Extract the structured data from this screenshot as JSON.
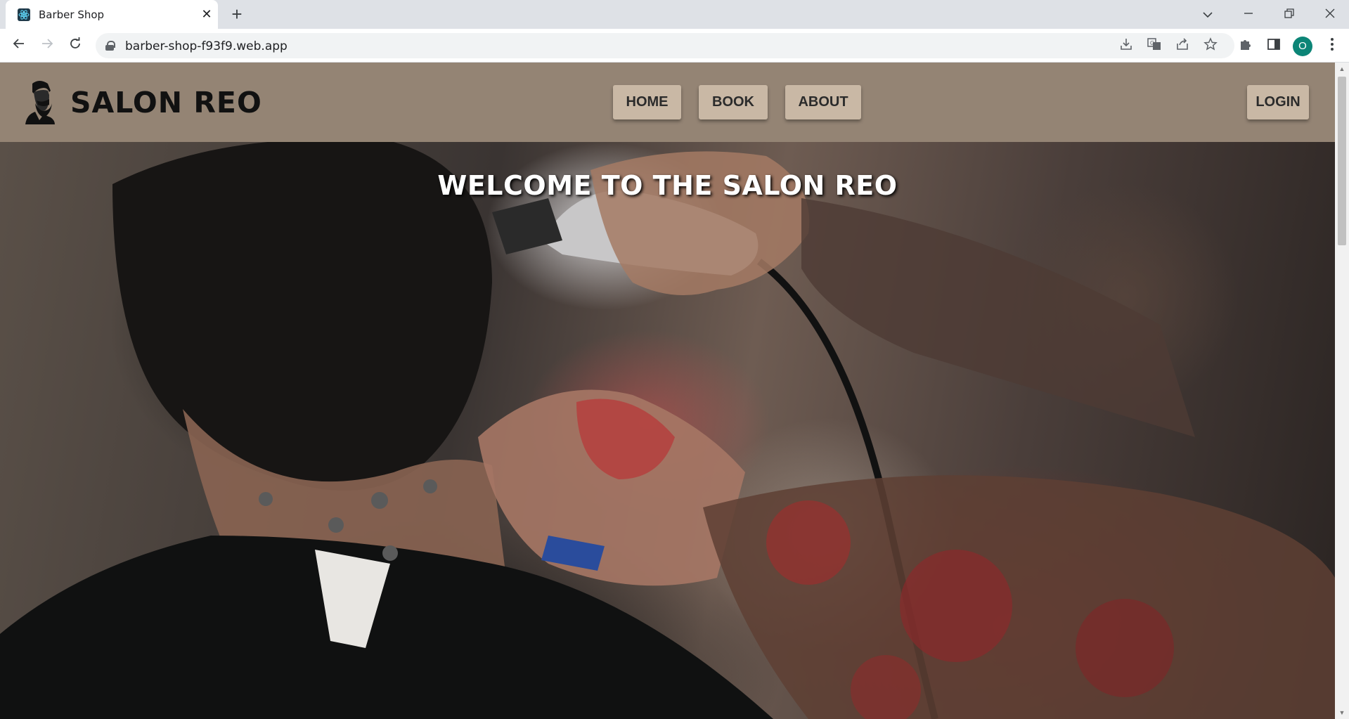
{
  "browser": {
    "tab_title": "Barber Shop",
    "url": "barber-shop-f93f9.web.app",
    "profile_initial": "O",
    "icons": {
      "favicon": "react-atom-icon",
      "tab_close": "close-icon",
      "new_tab": "plus-icon",
      "tab_search": "chevron-down-icon",
      "minimize": "minimize-icon",
      "restore": "restore-icon",
      "close_window": "close-icon",
      "back": "back-arrow-icon",
      "forward": "forward-arrow-icon",
      "reload": "reload-icon",
      "lock": "lock-icon",
      "install": "install-icon",
      "translate": "translate-icon",
      "share": "share-icon",
      "bookmark": "star-icon",
      "extensions": "puzzle-icon",
      "side_panel": "side-panel-icon",
      "menu": "kebab-menu-icon"
    }
  },
  "site": {
    "brand": "SALON REO",
    "logo_icon": "bearded-man-icon",
    "nav": {
      "home": "HOME",
      "book": "BOOK",
      "about": "ABOUT",
      "login": "LOGIN"
    },
    "colors": {
      "header_bg": "#948474",
      "button_bg": "#c9b8a5"
    }
  },
  "hero": {
    "title": "WELCOME TO THE SALON REO",
    "image": "barber-cutting-hair-photo"
  }
}
